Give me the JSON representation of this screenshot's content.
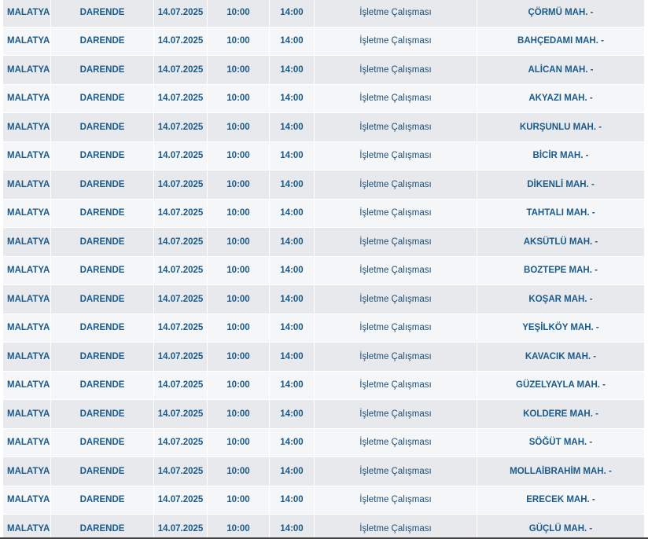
{
  "outage_list": {
    "rows": [
      {
        "city": "MALATYA",
        "district": "DARENDE",
        "date": "14.07.2025",
        "start": "10:00",
        "end": "14:00",
        "reason": "İşletme Çalışması",
        "area": "ÇÖRMÜ MAH. -"
      },
      {
        "city": "MALATYA",
        "district": "DARENDE",
        "date": "14.07.2025",
        "start": "10:00",
        "end": "14:00",
        "reason": "İşletme Çalışması",
        "area": "BAHÇEDAMI MAH. -"
      },
      {
        "city": "MALATYA",
        "district": "DARENDE",
        "date": "14.07.2025",
        "start": "10:00",
        "end": "14:00",
        "reason": "İşletme Çalışması",
        "area": "ALİCAN MAH. -"
      },
      {
        "city": "MALATYA",
        "district": "DARENDE",
        "date": "14.07.2025",
        "start": "10:00",
        "end": "14:00",
        "reason": "İşletme Çalışması",
        "area": "AKYAZI MAH. -"
      },
      {
        "city": "MALATYA",
        "district": "DARENDE",
        "date": "14.07.2025",
        "start": "10:00",
        "end": "14:00",
        "reason": "İşletme Çalışması",
        "area": "KURŞUNLU MAH. -"
      },
      {
        "city": "MALATYA",
        "district": "DARENDE",
        "date": "14.07.2025",
        "start": "10:00",
        "end": "14:00",
        "reason": "İşletme Çalışması",
        "area": "BİCİR MAH. -"
      },
      {
        "city": "MALATYA",
        "district": "DARENDE",
        "date": "14.07.2025",
        "start": "10:00",
        "end": "14:00",
        "reason": "İşletme Çalışması",
        "area": "DİKENLİ MAH. -"
      },
      {
        "city": "MALATYA",
        "district": "DARENDE",
        "date": "14.07.2025",
        "start": "10:00",
        "end": "14:00",
        "reason": "İşletme Çalışması",
        "area": "TAHTALI MAH. -"
      },
      {
        "city": "MALATYA",
        "district": "DARENDE",
        "date": "14.07.2025",
        "start": "10:00",
        "end": "14:00",
        "reason": "İşletme Çalışması",
        "area": "AKSÜTLÜ MAH. -"
      },
      {
        "city": "MALATYA",
        "district": "DARENDE",
        "date": "14.07.2025",
        "start": "10:00",
        "end": "14:00",
        "reason": "İşletme Çalışması",
        "area": "BOZTEPE MAH. -"
      },
      {
        "city": "MALATYA",
        "district": "DARENDE",
        "date": "14.07.2025",
        "start": "10:00",
        "end": "14:00",
        "reason": "İşletme Çalışması",
        "area": "KOŞAR MAH. -"
      },
      {
        "city": "MALATYA",
        "district": "DARENDE",
        "date": "14.07.2025",
        "start": "10:00",
        "end": "14:00",
        "reason": "İşletme Çalışması",
        "area": "YEŞİLKÖY MAH. -"
      },
      {
        "city": "MALATYA",
        "district": "DARENDE",
        "date": "14.07.2025",
        "start": "10:00",
        "end": "14:00",
        "reason": "İşletme Çalışması",
        "area": "KAVACIK MAH. -"
      },
      {
        "city": "MALATYA",
        "district": "DARENDE",
        "date": "14.07.2025",
        "start": "10:00",
        "end": "14:00",
        "reason": "İşletme Çalışması",
        "area": "GÜZELYAYLA MAH. -"
      },
      {
        "city": "MALATYA",
        "district": "DARENDE",
        "date": "14.07.2025",
        "start": "10:00",
        "end": "14:00",
        "reason": "İşletme Çalışması",
        "area": "KOLDERE MAH. -"
      },
      {
        "city": "MALATYA",
        "district": "DARENDE",
        "date": "14.07.2025",
        "start": "10:00",
        "end": "14:00",
        "reason": "İşletme Çalışması",
        "area": "SÖĞÜT MAH. -"
      },
      {
        "city": "MALATYA",
        "district": "DARENDE",
        "date": "14.07.2025",
        "start": "10:00",
        "end": "14:00",
        "reason": "İşletme Çalışması",
        "area": "MOLLAİBRAHİM MAH. -"
      },
      {
        "city": "MALATYA",
        "district": "DARENDE",
        "date": "14.07.2025",
        "start": "10:00",
        "end": "14:00",
        "reason": "İşletme Çalışması",
        "area": "ERECEK MAH. -"
      },
      {
        "city": "MALATYA",
        "district": "DARENDE",
        "date": "14.07.2025",
        "start": "10:00",
        "end": "14:00",
        "reason": "İşletme Çalışması",
        "area": "GÜÇLÜ MAH. -"
      }
    ]
  },
  "colors": {
    "text": "#1a5b8c",
    "row_odd": "#e8e9ec",
    "row_even": "#f5f6f7"
  }
}
